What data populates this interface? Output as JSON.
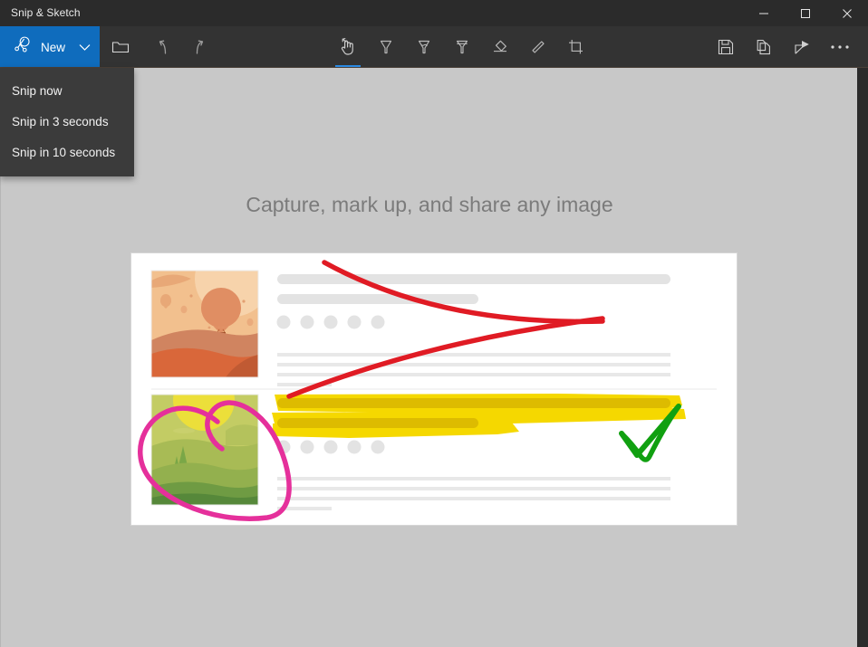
{
  "window": {
    "title": "Snip & Sketch",
    "controls": [
      {
        "name": "minimize",
        "glyph": "minimize-icon"
      },
      {
        "name": "maximize",
        "glyph": "maximize-icon"
      },
      {
        "name": "close",
        "glyph": "close-icon"
      }
    ]
  },
  "toolbar": {
    "new_label": "New",
    "new_icon": "snip-new-icon",
    "new_chevron_icon": "chevron-down-icon",
    "accent_color": "#0f6cbd",
    "selected_indicator_color": "#2a8ae4",
    "left_tools": [
      {
        "name": "open-file",
        "icon": "folder-icon",
        "label": "Open file"
      },
      {
        "name": "undo",
        "icon": "undo-icon",
        "label": "Undo"
      },
      {
        "name": "redo",
        "icon": "redo-icon",
        "label": "Redo"
      }
    ],
    "center_tools": [
      {
        "name": "touch-writing",
        "icon": "touch-writing-icon",
        "label": "Touch writing",
        "selected": true
      },
      {
        "name": "ballpoint-pen",
        "icon": "ballpoint-pen-icon",
        "label": "Ballpoint pen",
        "selected": false
      },
      {
        "name": "pencil",
        "icon": "pencil-icon",
        "label": "Pencil",
        "selected": false
      },
      {
        "name": "highlighter",
        "icon": "highlighter-icon",
        "label": "Highlighter",
        "selected": false
      },
      {
        "name": "eraser",
        "icon": "eraser-icon",
        "label": "Eraser",
        "selected": false
      },
      {
        "name": "ruler",
        "icon": "ruler-icon",
        "label": "Ruler",
        "selected": false
      },
      {
        "name": "crop",
        "icon": "crop-icon",
        "label": "Image crop",
        "selected": false
      }
    ],
    "right_tools": [
      {
        "name": "save",
        "icon": "save-icon",
        "label": "Save as"
      },
      {
        "name": "copy",
        "icon": "copy-icon",
        "label": "Copy"
      },
      {
        "name": "share",
        "icon": "share-icon",
        "label": "Share"
      },
      {
        "name": "see-more",
        "icon": "ellipsis-icon",
        "label": "See more"
      }
    ]
  },
  "new_menu": {
    "open": true,
    "items": [
      {
        "label": "Snip now"
      },
      {
        "label": "Snip in 3 seconds"
      },
      {
        "label": "Snip in 10 seconds"
      }
    ]
  },
  "canvas": {
    "background_color": "#c8c8c8",
    "headline": "Capture, mark up, and share any image",
    "headline_color": "#7b7b7b"
  },
  "illustration": {
    "name": "capture-markup-share-illustration",
    "card_background": "#ffffff",
    "card_border": "#d6d6d6",
    "placeholder_color": "#e3e3e3",
    "divider_color": "#ededed",
    "annotations": {
      "red_cross_color": "#e01b24",
      "pink_heart_color": "#e5309b",
      "yellow_highlight_color": "#f5d800",
      "yellow_highlight_over_bar_color": "#ddbb00",
      "green_check_color": "#11a011"
    },
    "thumbnails": [
      {
        "name": "balloon-thumbnail",
        "colors": {
          "sky": "#f2c08e",
          "sky_light": "#f7d3ab",
          "sun": "#f6cba2",
          "cloud": "#e8a877",
          "balloon": "#e08e63",
          "basket": "#a5532c",
          "hill_back": "#d08460",
          "hill_front": "#d9673a",
          "hill_shadow": "#c05a33"
        }
      },
      {
        "name": "landscape-thumbnail",
        "colors": {
          "sky": "#c3cc64",
          "sun": "#ecdf3a",
          "hill_back": "#b4c25c",
          "hill_mid": "#a8bb55",
          "hill_front": "#93b04e",
          "grass": "#6f9b43",
          "ground": "#56883a",
          "tree": "#7aa747"
        }
      }
    ]
  }
}
